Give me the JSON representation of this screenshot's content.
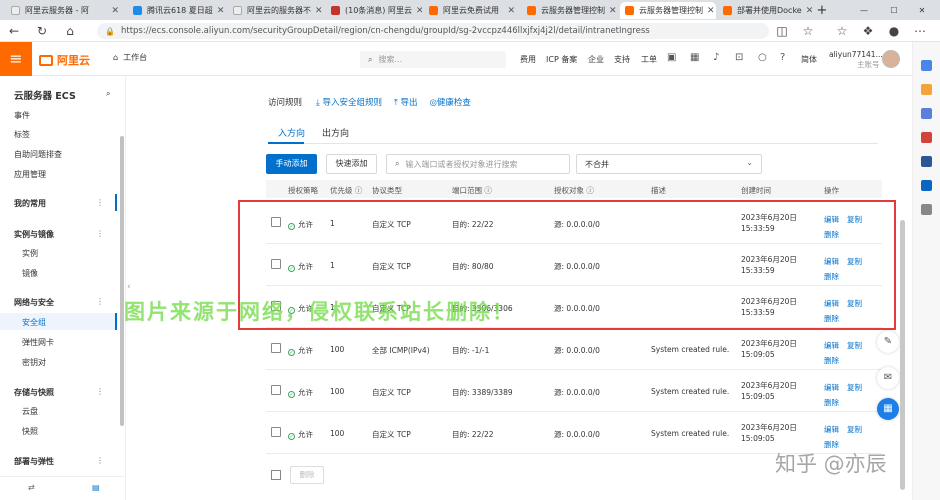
{
  "browser": {
    "tabs": [
      {
        "label": "阿里云服务器 - 阿",
        "color": "#ffffff"
      },
      {
        "label": "腾讯云618 夏日超",
        "color": "#1e8ceb"
      },
      {
        "label": "阿里云的服务器不",
        "color": "#ffffff"
      },
      {
        "label": "(10条消息) 阿里云",
        "color": "#c8322d"
      },
      {
        "label": "阿里云免费试用",
        "color": "#ff6a00"
      },
      {
        "label": "云服务器管理控制",
        "color": "#ff6a00"
      },
      {
        "label": "云服务器管理控制",
        "color": "#ff6a00"
      },
      {
        "label": "部署并使用Docke",
        "color": "#ff6a00"
      }
    ],
    "url": "https://ecs.console.aliyun.com/securityGroupDetail/region/cn-chengdu/groupId/sg-2vccpz446llxjfxj4j2l/detail/intranetIngress"
  },
  "console": {
    "brand": "阿里云",
    "workbench": "工作台",
    "search_placeholder": "搜索...",
    "nav": [
      "费用",
      "ICP 备案",
      "企业",
      "支持",
      "工单"
    ],
    "lang": "简体",
    "account_name": "aliyun77141...",
    "account_role": "主账号"
  },
  "sidebar": {
    "title": "云服务器 ECS",
    "items": [
      "事件",
      "标签",
      "自助问题排查",
      "应用管理"
    ],
    "favorites": "我的常用",
    "group_instances": "实例与镜像",
    "instances": [
      "实例",
      "镜像"
    ],
    "group_network": "网络与安全",
    "network": [
      "安全组",
      "弹性网卡",
      "密钥对"
    ],
    "group_storage": "存储与快照",
    "storage": [
      "云盘",
      "快照"
    ],
    "group_deploy": "部署与弹性"
  },
  "page": {
    "title": "访问规则",
    "links": [
      "导入安全组规则",
      "导出",
      "健康检查"
    ],
    "tabs": [
      "入方向",
      "出方向"
    ],
    "add_button": "手动添加",
    "quick_add": "快速添加",
    "filter_placeholder": "输入端口或者授权对象进行搜索",
    "select_value": "不合并",
    "columns": [
      "授权策略",
      "优先级",
      "协议类型",
      "端口范围",
      "授权对象",
      "描述",
      "创建时间",
      "操作"
    ],
    "rows": [
      {
        "policy": "允许",
        "priority": "1",
        "protocol": "自定义 TCP",
        "port": "目的: 22/22",
        "source": "源: 0.0.0.0/0",
        "desc": "",
        "date": "2023年6月20日",
        "time": "15:33:59"
      },
      {
        "policy": "允许",
        "priority": "1",
        "protocol": "自定义 TCP",
        "port": "目的: 80/80",
        "source": "源: 0.0.0.0/0",
        "desc": "",
        "date": "2023年6月20日",
        "time": "15:33:59"
      },
      {
        "policy": "允许",
        "priority": "1",
        "protocol": "自定义 TCP",
        "port": "目的: 3306/3306",
        "source": "源: 0.0.0.0/0",
        "desc": "",
        "date": "2023年6月20日",
        "time": "15:33:59"
      },
      {
        "policy": "允许",
        "priority": "100",
        "protocol": "全部 ICMP(IPv4)",
        "port": "目的: -1/-1",
        "source": "源: 0.0.0.0/0",
        "desc": "System created rule.",
        "date": "2023年6月20日",
        "time": "15:09:05"
      },
      {
        "policy": "允许",
        "priority": "100",
        "protocol": "自定义 TCP",
        "port": "目的: 3389/3389",
        "source": "源: 0.0.0.0/0",
        "desc": "System created rule.",
        "date": "2023年6月20日",
        "time": "15:09:05"
      },
      {
        "policy": "允许",
        "priority": "100",
        "protocol": "自定义 TCP",
        "port": "目的: 22/22",
        "source": "源: 0.0.0.0/0",
        "desc": "System created rule.",
        "date": "2023年6月20日",
        "time": "15:09:05"
      }
    ],
    "ops": {
      "edit": "编辑",
      "copy": "复制",
      "delete": "删除"
    },
    "bulk_delete": "删除"
  },
  "overlays": {
    "watermark": "图片来源于网络，侵权联系站长删除！",
    "credit": "知乎 @亦辰"
  },
  "colors": {
    "accent": "#0070cc",
    "brand": "#ff6a00",
    "highlight": "#e53a3a"
  }
}
